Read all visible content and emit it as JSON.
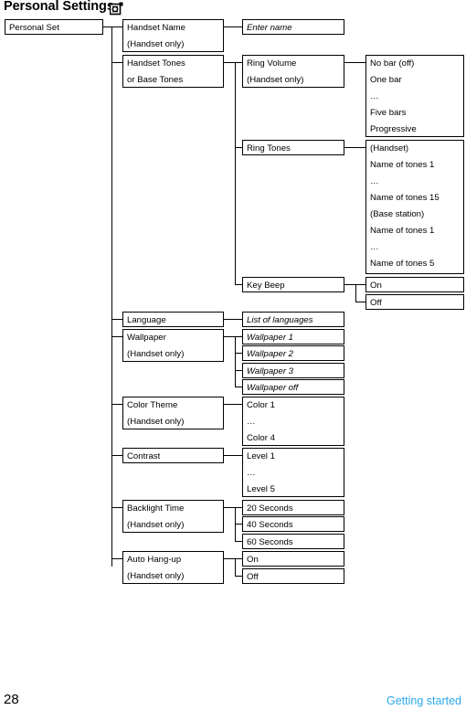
{
  "page": {
    "title": "Personal Settings",
    "title_icon": "handset-menu-icon",
    "footer_page_number": "28",
    "footer_section": "Getting started",
    "link_color": "#2aa8e8"
  },
  "tree": {
    "root": {
      "label": "Personal Set"
    },
    "level2": [
      {
        "name": "handset-name",
        "lines": [
          "Handset Name",
          "(Handset only)"
        ]
      },
      {
        "name": "handset-tones",
        "lines": [
          "Handset Tones",
          "or Base Tones"
        ]
      },
      {
        "name": "language",
        "lines": [
          "Language"
        ]
      },
      {
        "name": "wallpaper",
        "lines": [
          "Wallpaper",
          "(Handset only)"
        ]
      },
      {
        "name": "color-theme",
        "lines": [
          "Color Theme",
          "(Handset only)"
        ]
      },
      {
        "name": "contrast",
        "lines": [
          "Contrast"
        ]
      },
      {
        "name": "backlight-time",
        "lines": [
          "Backlight Time",
          "(Handset only)"
        ]
      },
      {
        "name": "auto-hang-up",
        "lines": [
          "Auto Hang-up",
          "(Handset only)"
        ]
      }
    ],
    "level3": {
      "enter_name": {
        "lines": [
          "Enter name"
        ],
        "italic": true
      },
      "ring_volume": {
        "lines": [
          "Ring Volume",
          "(Handset only)"
        ]
      },
      "ring_tones": {
        "lines": [
          "Ring Tones"
        ]
      },
      "key_beep": {
        "lines": [
          "Key Beep"
        ]
      },
      "list_of_languages": {
        "lines": [
          "List of languages"
        ],
        "italic": true
      },
      "wallpaper_1": {
        "lines": [
          "Wallpaper 1"
        ],
        "italic": true
      },
      "wallpaper_2": {
        "lines": [
          "Wallpaper 2"
        ],
        "italic": true
      },
      "wallpaper_3": {
        "lines": [
          "Wallpaper 3"
        ],
        "italic": true
      },
      "wallpaper_off": {
        "lines": [
          "Wallpaper off"
        ],
        "italic": true
      },
      "color_list": {
        "lines": [
          "Color 1",
          "…",
          "Color 4"
        ]
      },
      "level_list": {
        "lines": [
          "Level 1",
          "…",
          "Level 5"
        ]
      },
      "sec20": {
        "lines": [
          "20 Seconds"
        ]
      },
      "sec40": {
        "lines": [
          "40 Seconds"
        ]
      },
      "sec60": {
        "lines": [
          "60 Seconds"
        ]
      },
      "hangup_on": {
        "lines": [
          "On"
        ]
      },
      "hangup_off": {
        "lines": [
          "Off"
        ]
      }
    },
    "level4": {
      "ring_volume_options": {
        "lines": [
          "No bar (off)",
          "One bar",
          "…",
          "Five bars",
          "Progressive"
        ]
      },
      "ring_tones_options": {
        "lines": [
          "(Handset)",
          "Name of tones 1",
          "…",
          "Name of tones 15",
          "(Base station)",
          "Name of tones 1",
          "…",
          "Name of tones 5"
        ]
      },
      "key_beep_on": {
        "lines": [
          "On"
        ]
      },
      "key_beep_off": {
        "lines": [
          "Off"
        ]
      }
    }
  }
}
